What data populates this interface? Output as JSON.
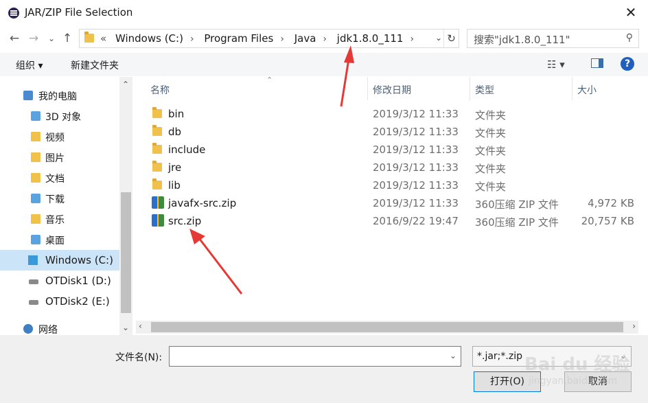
{
  "window": {
    "title": "JAR/ZIP File Selection",
    "close_glyph": "✕"
  },
  "nav": {
    "back_glyph": "←",
    "forward_glyph": "→",
    "recent_glyph": "⌄",
    "up_glyph": "↑",
    "address_overflow": "«",
    "breadcrumbs": [
      "Windows (C:)",
      "Program Files",
      "Java",
      "jdk1.8.0_111"
    ],
    "crumb_sep": "›",
    "dropdown_glyph": "⌄",
    "refresh_glyph": "↻",
    "search_placeholder": "搜索\"jdk1.8.0_111\"",
    "search_glyph": "⚲"
  },
  "toolbar": {
    "organize_label": "组织 ▾",
    "new_folder_label": "新建文件夹",
    "view_glyph": "☷ ▾",
    "help_glyph": "?"
  },
  "sidebar": {
    "items": [
      {
        "label": "我的电脑",
        "icon": "computer-icon"
      },
      {
        "label": "3D 对象",
        "icon": "3d-objects-icon"
      },
      {
        "label": "视频",
        "icon": "videos-icon"
      },
      {
        "label": "图片",
        "icon": "pictures-icon"
      },
      {
        "label": "文档",
        "icon": "documents-icon"
      },
      {
        "label": "下载",
        "icon": "downloads-icon"
      },
      {
        "label": "音乐",
        "icon": "music-icon"
      },
      {
        "label": "桌面",
        "icon": "desktop-icon"
      },
      {
        "label": "Windows (C:)",
        "icon": "windows-drive-icon",
        "selected": true
      },
      {
        "label": "OTDisk1 (D:)",
        "icon": "drive-icon"
      },
      {
        "label": "OTDisk2 (E:)",
        "icon": "drive-icon"
      },
      {
        "label": "网络",
        "icon": "network-icon"
      }
    ],
    "scroll_up_glyph": "⌃",
    "scroll_down_glyph": "⌄"
  },
  "files": {
    "columns": {
      "name": "名称",
      "modified": "修改日期",
      "type": "类型",
      "size": "大小"
    },
    "sort_glyph": "⌃",
    "rows": [
      {
        "name": "bin",
        "modified": "2019/3/12 11:33",
        "type": "文件夹",
        "size": "",
        "icon": "folder-icon"
      },
      {
        "name": "db",
        "modified": "2019/3/12 11:33",
        "type": "文件夹",
        "size": "",
        "icon": "folder-icon"
      },
      {
        "name": "include",
        "modified": "2019/3/12 11:33",
        "type": "文件夹",
        "size": "",
        "icon": "folder-icon"
      },
      {
        "name": "jre",
        "modified": "2019/3/12 11:33",
        "type": "文件夹",
        "size": "",
        "icon": "folder-icon"
      },
      {
        "name": "lib",
        "modified": "2019/3/12 11:33",
        "type": "文件夹",
        "size": "",
        "icon": "folder-icon"
      },
      {
        "name": "javafx-src.zip",
        "modified": "2019/3/12 11:33",
        "type": "360压缩 ZIP 文件",
        "size": "4,972 KB",
        "icon": "zip-archive-icon"
      },
      {
        "name": "src.zip",
        "modified": "2016/9/22 19:47",
        "type": "360压缩 ZIP 文件",
        "size": "20,757 KB",
        "icon": "zip-archive-icon"
      }
    ],
    "hscroll_left_glyph": "‹",
    "hscroll_right_glyph": "›"
  },
  "bottom": {
    "filename_label": "文件名(N):",
    "filename_value": "",
    "dropdown_glyph": "⌄",
    "filter_value": "*.jar;*.zip",
    "open_label": "打开(O)",
    "cancel_label": "取消"
  },
  "watermark": {
    "main": "Bai du 经验",
    "sub": "jingyan.baidu.com"
  },
  "annotation": {
    "arrow_color": "#e53935"
  }
}
